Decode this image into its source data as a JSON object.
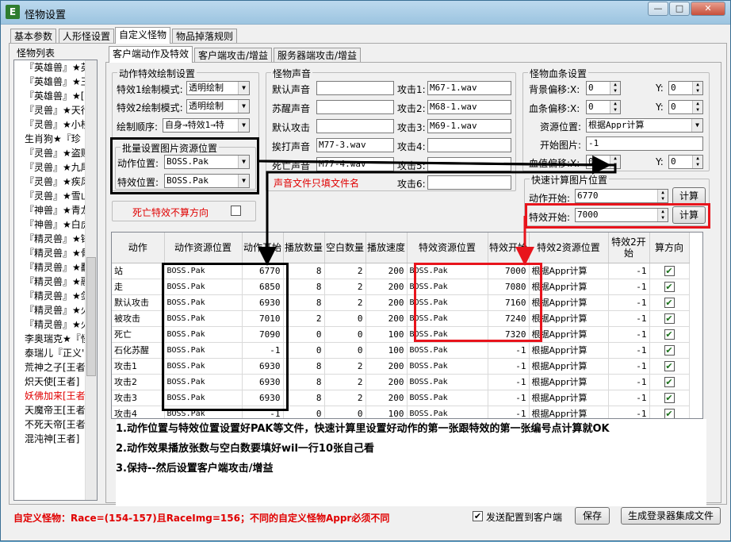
{
  "window": {
    "title": "怪物设置"
  },
  "main_tabs": [
    "基本参数",
    "人形怪设置",
    "自定义怪物",
    "物品掉落规则"
  ],
  "sub_tabs": [
    "客户端动作及特效",
    "客户端攻击/增益",
    "服务器端攻击/增益"
  ],
  "monster_list": {
    "label": "怪物列表",
    "items": [
      "『英雄兽』★英",
      "『英雄兽』★王",
      "『英雄兽』★[",
      "『灵兽』★天行",
      "『灵兽』★小楼",
      "生肖狗★『珍",
      "『灵兽』★盗贼",
      "『灵兽』★九尾",
      "『灵兽』★疾风",
      "『灵兽』★雪山",
      "『神兽』★青龙",
      "『神兽』★白虎",
      "『精灵兽』★锋",
      "『精灵兽』★骨",
      "『精灵兽』★翻",
      "『精灵兽』★融",
      "『精灵兽』★剑",
      "『精灵兽』★火",
      "『精灵兽』★火",
      "李奥瑞克★『怪",
      "泰瑞儿『正义','迪亚波罗『恐怖",
      "荒神之子[王者",
      "炽天使[王者]",
      "妖佛加来[王者",
      "天魔帝王[王者",
      "不死天帝[王者",
      "混沌神[王者]"
    ],
    "selected_index": 23
  },
  "action_effect_group": {
    "label": "动作特效绘制设置",
    "effect1_mode_label": "特效1绘制模式:",
    "effect1_mode": "透明绘制",
    "effect2_mode_label": "特效2绘制模式:",
    "effect2_mode": "透明绘制",
    "draw_order_label": "绘制顺序:",
    "draw_order": "自身→特效1→特"
  },
  "batch_group": {
    "label": "批量设置图片资源位置",
    "action_pos_label": "动作位置:",
    "action_pos": "BOSS.Pak",
    "effect_pos_label": "特效位置:",
    "effect_pos": "BOSS.Pak"
  },
  "death_effect": {
    "label": "死亡特效不算方向",
    "checked": false
  },
  "sound_group": {
    "label": "怪物声音",
    "default_sound_label": "默认声音",
    "default_sound": "",
    "wake_sound_label": "苏醒声音",
    "wake_sound": "",
    "default_attack_label": "默认攻击",
    "default_attack": "",
    "hit_sound_label": "挨打声音",
    "hit_sound": "M77-3.wav",
    "death_sound_label": "死亡声音",
    "death_sound": "M77-4.wav",
    "attack1_label": "攻击1:",
    "attack1": "M67-1.wav",
    "attack2_label": "攻击2:",
    "attack2": "M68-1.wav",
    "attack3_label": "攻击3:",
    "attack3": "M69-1.wav",
    "attack4_label": "攻击4:",
    "attack4": "",
    "attack5_label": "攻击5:",
    "attack5": "",
    "attack6_label": "攻击6:",
    "attack6": "",
    "note": "声音文件只填文件名"
  },
  "hp_bar_group": {
    "label": "怪物血条设置",
    "bg_offset_x_label": "背景偏移:X:",
    "bg_offset_x": "0",
    "bg_offset_y_label": "Y:",
    "bg_offset_y": "0",
    "bar_offset_x_label": "血条偏移:X:",
    "bar_offset_x": "0",
    "bar_offset_y_label": "Y:",
    "bar_offset_y": "0",
    "res_pos_label": "资源位置:",
    "res_pos": "根据Appr计算",
    "start_img_label": "开始图片:",
    "start_img": "-1",
    "value_offset_x_label": "血值偏移:X:",
    "value_offset_x": "0",
    "value_offset_y_label": "Y:",
    "value_offset_y": "0"
  },
  "calc_group": {
    "label": "快速计算图片位置",
    "action_start_label": "动作开始:",
    "action_start": "6770",
    "effect_start_label": "特效开始:",
    "effect_start": "7000",
    "calc_button": "计算"
  },
  "table": {
    "headers": [
      "动作",
      "动作资源位置",
      "动作开始",
      "播放数量",
      "空白数量",
      "播放速度",
      "特效资源位置",
      "特效开始",
      "特效2资源位置",
      "特效2开 始",
      "算方向"
    ],
    "rows": [
      [
        "站",
        "BOSS.Pak",
        "6770",
        "8",
        "2",
        "200",
        "BOSS.Pak",
        "7000",
        "根据Appr计算",
        "-1",
        "✔"
      ],
      [
        "走",
        "BOSS.Pak",
        "6850",
        "8",
        "2",
        "200",
        "BOSS.Pak",
        "7080",
        "根据Appr计算",
        "-1",
        "✔"
      ],
      [
        "默认攻击",
        "BOSS.Pak",
        "6930",
        "8",
        "2",
        "200",
        "BOSS.Pak",
        "7160",
        "根据Appr计算",
        "-1",
        "✔"
      ],
      [
        "被攻击",
        "BOSS.Pak",
        "7010",
        "2",
        "0",
        "200",
        "BOSS.Pak",
        "7240",
        "根据Appr计算",
        "-1",
        "✔"
      ],
      [
        "死亡",
        "BOSS.Pak",
        "7090",
        "0",
        "0",
        "100",
        "BOSS.Pak",
        "7320",
        "根据Appr计算",
        "-1",
        "✔"
      ],
      [
        "石化苏醒",
        "BOSS.Pak",
        "-1",
        "0",
        "0",
        "100",
        "BOSS.Pak",
        "-1",
        "根据Appr计算",
        "-1",
        "✔"
      ],
      [
        "攻击1",
        "BOSS.Pak",
        "6930",
        "8",
        "2",
        "200",
        "BOSS.Pak",
        "-1",
        "根据Appr计算",
        "-1",
        "✔"
      ],
      [
        "攻击2",
        "BOSS.Pak",
        "6930",
        "8",
        "2",
        "200",
        "BOSS.Pak",
        "-1",
        "根据Appr计算",
        "-1",
        "✔"
      ],
      [
        "攻击3",
        "BOSS.Pak",
        "6930",
        "8",
        "2",
        "200",
        "BOSS.Pak",
        "-1",
        "根据Appr计算",
        "-1",
        "✔"
      ],
      [
        "攻击4",
        "BOSS.Pak",
        "-1",
        "0",
        "0",
        "100",
        "BOSS.Pak",
        "-1",
        "根据Appr计算",
        "-1",
        "✔"
      ]
    ]
  },
  "instructions": [
    "1.动作位置与特效位置设置好PAK等文件，快速计算里设置好动作的第一张跟特效的第一张编号点计算就OK",
    "2.动作效果播放张数与空白数要填好wil一行10张自己看",
    "3.保持--然后设置客户端攻击/增益"
  ],
  "footer": {
    "status": "自定义怪物：Race=(154-157)且RaceImg=156；不同的自定义怪物Appr必须不同",
    "send_to_client_label": "发送配置到客户端",
    "send_to_client_checked": true,
    "save_button": "保存",
    "generate_button": "生成登录器集成文件"
  },
  "colors": {
    "annotation_black": "#000000",
    "annotation_red": "#e8141c",
    "status_red": "#e00000"
  }
}
